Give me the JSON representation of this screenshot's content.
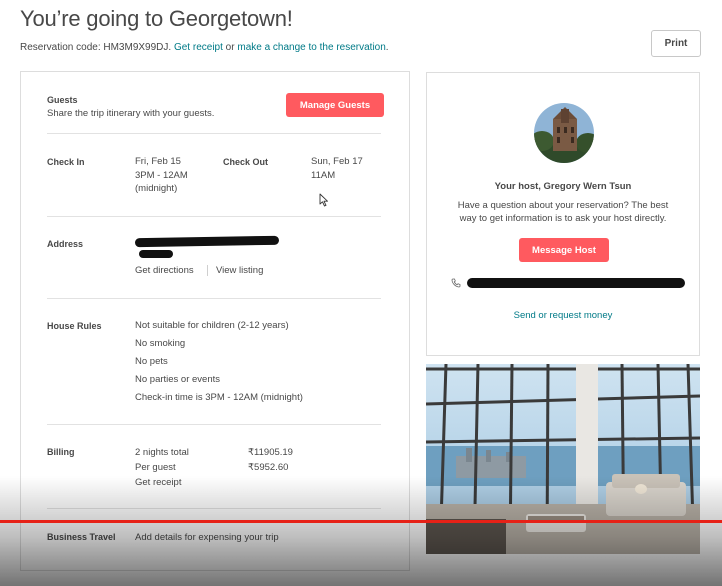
{
  "header": {
    "title": "You’re going to Georgetown!",
    "reservation_prefix": "Reservation code: HM3M9X99DJ.",
    "get_receipt": "Get receipt",
    "or_text": "or",
    "make_change": "make a change to the reservation",
    "period": ".",
    "print_label": "Print"
  },
  "guests": {
    "label": "Guests",
    "description": "Share the trip itinerary with your guests.",
    "manage_button": "Manage Guests"
  },
  "checkin": {
    "label": "Check In",
    "date": "Fri, Feb 15",
    "time": "3PM - 12AM",
    "note": "(midnight)"
  },
  "checkout": {
    "label": "Check Out",
    "date": "Sun, Feb 17",
    "time": "11AM"
  },
  "address": {
    "label": "Address",
    "directions": "Get directions",
    "view_listing": "View listing"
  },
  "house_rules": {
    "label": "House Rules",
    "items": [
      "Not suitable for children (2-12 years)",
      "No smoking",
      "No pets",
      "No parties or events",
      "Check-in time is 3PM - 12AM (midnight)"
    ]
  },
  "billing": {
    "label": "Billing",
    "total_label": "2 nights total",
    "total_value": "₹11905.19",
    "per_guest_label": "Per guest",
    "per_guest_value": "₹5952.60",
    "get_receipt": "Get receipt"
  },
  "business": {
    "label": "Business Travel",
    "link": "Add details for expensing your trip"
  },
  "host": {
    "name": "Your host, Gregory Wern Tsun",
    "question": "Have a question about your reservation? The best way to get information is to ask your host directly.",
    "message_button": "Message Host",
    "send_money": "Send or request money"
  },
  "colors": {
    "accent": "#ff5a5f",
    "link": "#007a87",
    "text": "#484848",
    "video_progress": "#e62117"
  },
  "icons": {
    "phone": "phone-icon",
    "cursor": "mouse-cursor-icon"
  }
}
